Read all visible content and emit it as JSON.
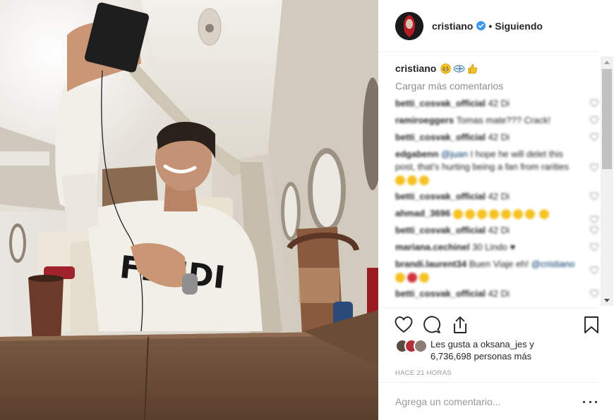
{
  "header": {
    "username": "cristiano",
    "separator": "•",
    "follow_status": "Siguiendo"
  },
  "caption": {
    "username": "cristiano"
  },
  "comments": {
    "load_more": "Cargar más comentarios",
    "items": [
      {
        "user": "betti_cosvak_official",
        "text": "42 Di"
      },
      {
        "user": "ramiroeggers",
        "text": "Tomas mate??? Crack!"
      },
      {
        "user": "betti_cosvak_official",
        "text": "42 Di"
      },
      {
        "user": "edgabenn",
        "mention": "@juan",
        "text": "I hope he will delet this post, that's hurting being a fan from rarities"
      },
      {
        "user": "betti_cosvak_official",
        "text": "42 Di"
      },
      {
        "user": "ahmad_3696",
        "text": ""
      },
      {
        "user": "betti_cosvak_official",
        "text": "42 Di"
      },
      {
        "user": "mariana.cechinel",
        "text": "30 Lindo"
      },
      {
        "user": "brandi.laurent34",
        "text": "Buen Viaje eh!",
        "mention": "@cristiano"
      },
      {
        "user": "betti_cosvak_official",
        "text": "42 Di"
      }
    ]
  },
  "likes": {
    "prefix": "Les gusta a",
    "user": "oksana_jes",
    "mid": "y",
    "count": "6,736,698",
    "suffix": "personas más"
  },
  "timestamp": "HACE 21 HORAS",
  "add_comment": {
    "placeholder": "Agrega un comentario..."
  },
  "icons": {
    "verified": "verified-badge-icon",
    "like": "heart-icon",
    "comment": "comment-icon",
    "share": "share-icon",
    "save": "bookmark-icon",
    "more": "more-options-icon"
  },
  "colors": {
    "verified": "#3897f0",
    "text": "#262626",
    "muted": "#8e8e8e",
    "border": "#efefef"
  }
}
